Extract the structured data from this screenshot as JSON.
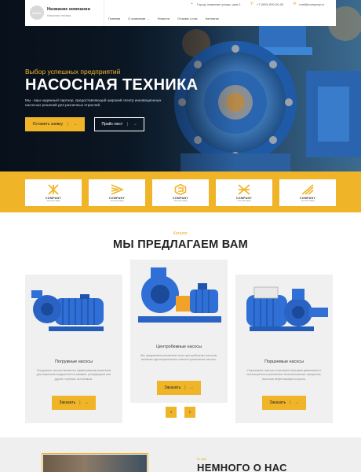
{
  "header": {
    "logo_text": "LOGO",
    "company_name": "Название компании",
    "company_sub": "Насосная техника",
    "address": "Город, название улицы, дом 1",
    "phone": "+7 (000) 000-00-00",
    "email": "mail@company.ru",
    "nav": [
      {
        "label": "Главная"
      },
      {
        "label": "О компании"
      },
      {
        "label": "Новости"
      },
      {
        "label": "Отзывы о нас"
      },
      {
        "label": "Контакты"
      }
    ]
  },
  "hero": {
    "kicker": "Выбор успешных предприятий",
    "title": "НАСОСНАЯ ТЕХНИКА",
    "description": "Мы - ваш надежный партнер, предоставляющий широкий спектр инновационных насосных решений для различных отраслей.",
    "order_button": "Оставить заявку",
    "price_button": "Прайс-лист"
  },
  "logos": [
    {
      "name": "COMPANY",
      "tag": "TAGLINE HERE"
    },
    {
      "name": "COMPANY",
      "tag": "TAGLINE HERE"
    },
    {
      "name": "COMPANY",
      "tag": "TAGLINE HERE"
    },
    {
      "name": "COMPANY",
      "tag": "TAGLINE HERE"
    },
    {
      "name": "COMPANY",
      "tag": "TAGLINE HERE"
    }
  ],
  "catalog": {
    "kicker": "Каталог",
    "title": "МЫ ПРЕДЛАГАЕМ ВАМ",
    "items": [
      {
        "title": "Погружные насосы",
        "description": "Погружные насосы являются эффективным решением для перекачки жидкостей из скважин, резервуаров или других глубоких источников.",
        "button": "Заказать"
      },
      {
        "title": "Центробежные насосы",
        "description": "Мы предлагаем различные типы центробежных насосов, включая одноступенчатые и многоступенчатые насосы.",
        "button": "Заказать"
      },
      {
        "title": "Поршневые насосы",
        "description": "Поршневые насосы отличаются высоким давлением и используются в различных технологических процессах, включая нефтегазовую отрасль.",
        "button": "Заказать"
      }
    ],
    "prev_icon": "‹",
    "next_icon": "›"
  },
  "about": {
    "kicker": "О нас",
    "title": "НЕМНОГО О НАС"
  },
  "colors": {
    "accent": "#f0b429",
    "hero_dark": "#0d1a27",
    "pump_blue": "#2f6fd6"
  },
  "icons": {
    "address": "location-pin-icon",
    "phone": "phone-icon",
    "email": "mail-icon",
    "arrow": "arrow-right-icon"
  }
}
